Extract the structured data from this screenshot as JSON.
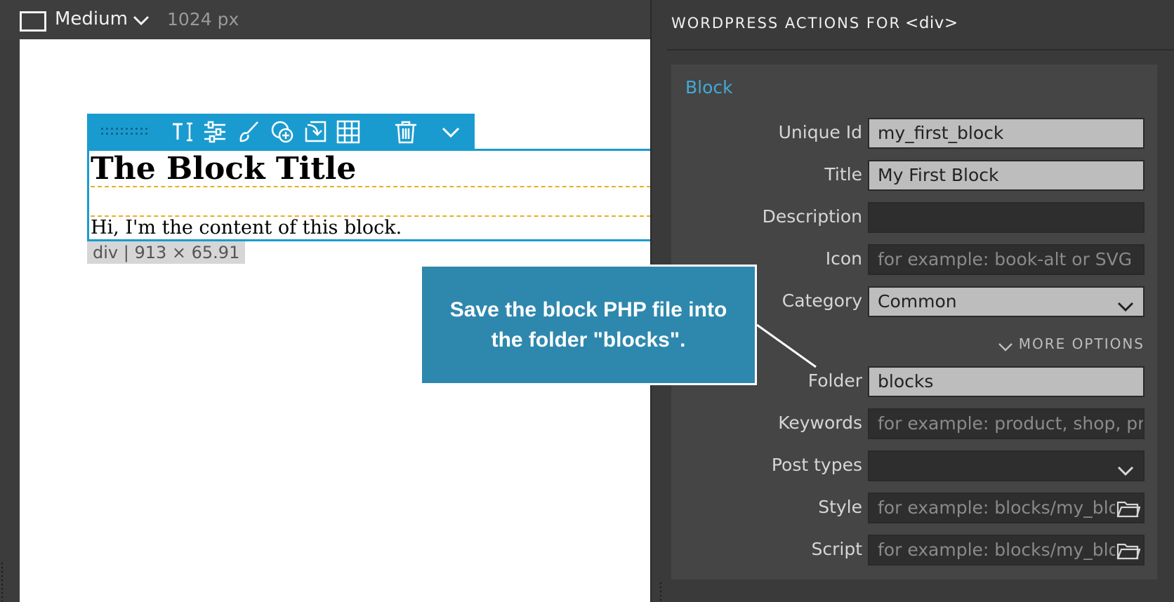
{
  "topbar": {
    "device_size": "Medium",
    "width_label": "1024 px",
    "icons": [
      "device-frame-icon",
      "chevron-down-icon"
    ]
  },
  "toolbar": {
    "icons": [
      "drag-handle",
      "text-cursor-icon",
      "sliders-icon",
      "paint-brush-icon",
      "add-circle-icon",
      "insert-icon",
      "grid-icon",
      "trash-icon",
      "chevron-down-icon"
    ]
  },
  "canvas": {
    "block_title": "The Block Title",
    "block_content": "Hi, I'm the content of this block.",
    "dimension_badge": "div | 913 × 65.91"
  },
  "callout": {
    "text": "Save the block PHP file into the folder \"blocks\"."
  },
  "panel": {
    "header": "WORDPRESS ACTIONS FOR",
    "header_tag": "<div>",
    "group_title": "Block",
    "more_options": "MORE OPTIONS",
    "fields": {
      "unique_id": {
        "label": "Unique Id",
        "value": "my_first_block"
      },
      "title": {
        "label": "Title",
        "value": "My First Block"
      },
      "description": {
        "label": "Description",
        "value": ""
      },
      "icon": {
        "label": "Icon",
        "placeholder": "for example: book-alt or SVG"
      },
      "category": {
        "label": "Category",
        "value": "Common"
      },
      "folder": {
        "label": "Folder",
        "value": "blocks"
      },
      "keywords": {
        "label": "Keywords",
        "placeholder": "for example: product, shop, pro"
      },
      "post_types": {
        "label": "Post types",
        "value": ""
      },
      "style": {
        "label": "Style",
        "placeholder": "for example: blocks/my_bloc"
      },
      "script": {
        "label": "Script",
        "placeholder": "for example: blocks/my_bloc"
      }
    }
  },
  "colors": {
    "accent": "#1a9bd0",
    "callout_bg": "#2e88ad",
    "group_title": "#43a9d6",
    "guide_dash": "#e8b01c"
  }
}
